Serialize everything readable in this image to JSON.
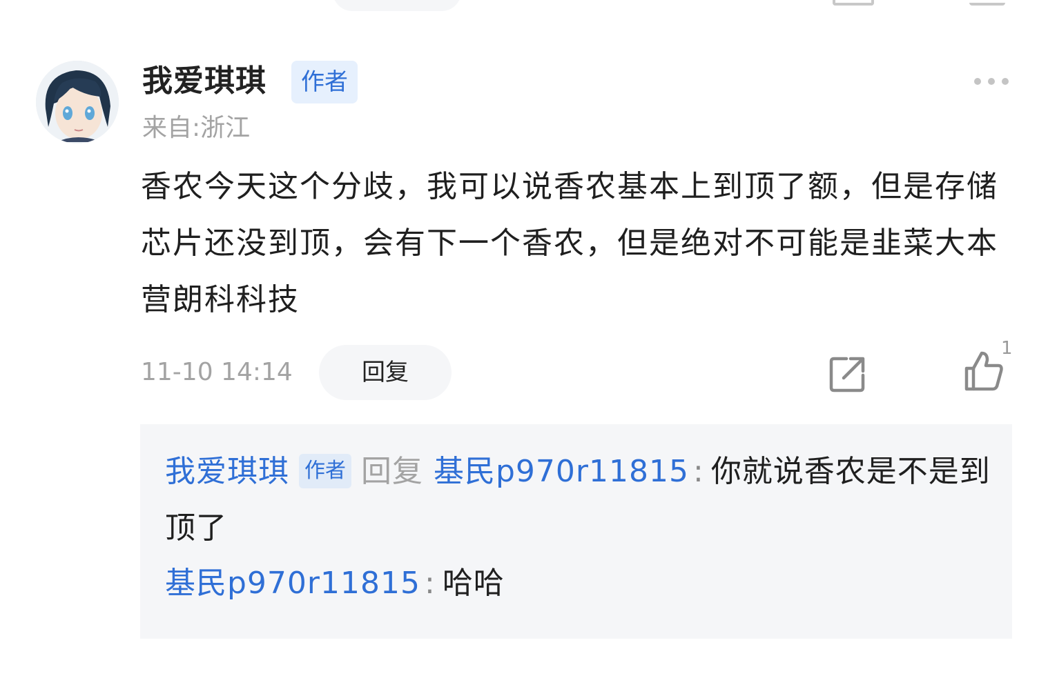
{
  "comment": {
    "username": "我爱琪琪",
    "author_badge": "作者",
    "location": "来自:浙江",
    "content": "香农今天这个分歧，我可以说香农基本上到顶了额，但是存储芯片还没到顶，会有下一个香农，但是绝对不可能是韭菜大本营朗科科技",
    "timestamp": "11-10 14:14",
    "reply_label": "回复",
    "like_count": "1",
    "icons": {
      "more": "more-dots-icon",
      "share": "share-icon",
      "like": "thumbs-up-icon"
    }
  },
  "replies": [
    {
      "author": "我爱琪琪",
      "author_badge": "作者",
      "reply_word": "回复",
      "target": "基民p970r11815",
      "colon": ":",
      "text": "你就说香农是不是到顶了"
    },
    {
      "author": "基民p970r11815",
      "colon": ":",
      "text": "哈哈"
    }
  ],
  "colors": {
    "link": "#2f6fd6",
    "badge_bg": "#e6f0fd",
    "muted": "#a3a3a3",
    "panel_bg": "#f5f6f8"
  }
}
